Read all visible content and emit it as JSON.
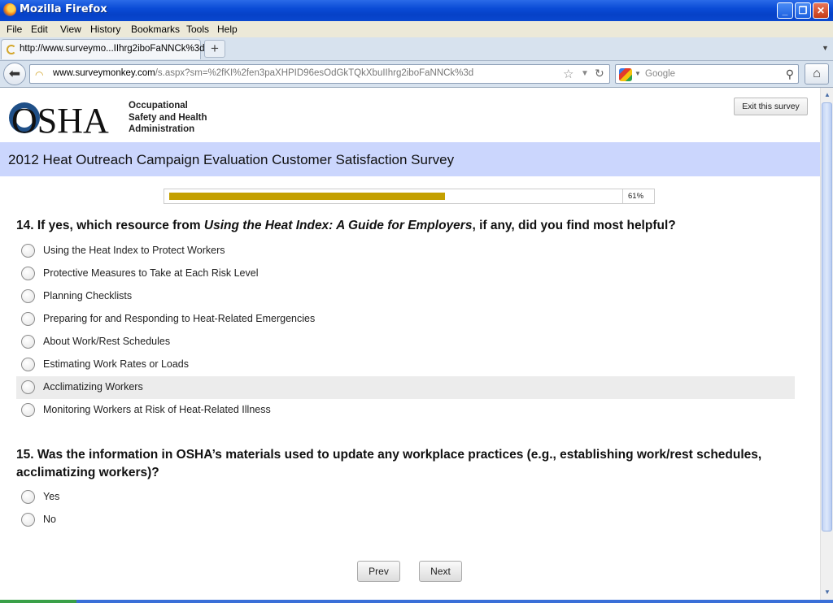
{
  "window": {
    "title": "Mozilla Firefox"
  },
  "menu": [
    "File",
    "Edit",
    "View",
    "History",
    "Bookmarks",
    "Tools",
    "Help"
  ],
  "tab": {
    "title": "http://www.surveymo...IIhrg2iboFaNNCk%3d"
  },
  "address": {
    "domain": "www.surveymonkey.com",
    "path": "/s.aspx?sm=%2fKI%2fen3paXHPID96esOdGkTQkXbuIIhrg2iboFaNNCk%3d"
  },
  "search": {
    "placeholder": "Google"
  },
  "header": {
    "org_lines": [
      "Occupational",
      "Safety and Health",
      "Administration"
    ],
    "logo_text": "OSHA",
    "exit_label": "Exit this survey"
  },
  "survey": {
    "title": "2012 Heat Outreach Campaign Evaluation Customer Satisfaction Survey",
    "progress_fraction": 0.61,
    "progress_label": "61%"
  },
  "q14": {
    "prefix": "14. If yes, which resource from ",
    "italic": "Using the Heat Index: A Guide for Employers",
    "suffix": ", if any, did you find most helpful?",
    "options": [
      "Using the Heat Index to Protect Workers",
      "Protective Measures to Take at Each Risk Level",
      "Planning Checklists",
      "Preparing for and Responding to Heat-Related Emergencies",
      "About Work/Rest Schedules",
      "Estimating Work Rates or Loads",
      "Acclimatizing Workers",
      "Monitoring Workers at Risk of Heat-Related Illness"
    ]
  },
  "q15": {
    "text": "15. Was the information in OSHA’s materials used to update any workplace practices (e.g., establishing work/rest schedules, acclimatizing workers)?",
    "options": [
      "Yes",
      "No"
    ]
  },
  "buttons": {
    "prev": "Prev",
    "next": "Next"
  },
  "colors": {
    "banner": "#cbd6fd",
    "progress_fill": "#c4a000",
    "titlebar": "#0a4bd6"
  }
}
